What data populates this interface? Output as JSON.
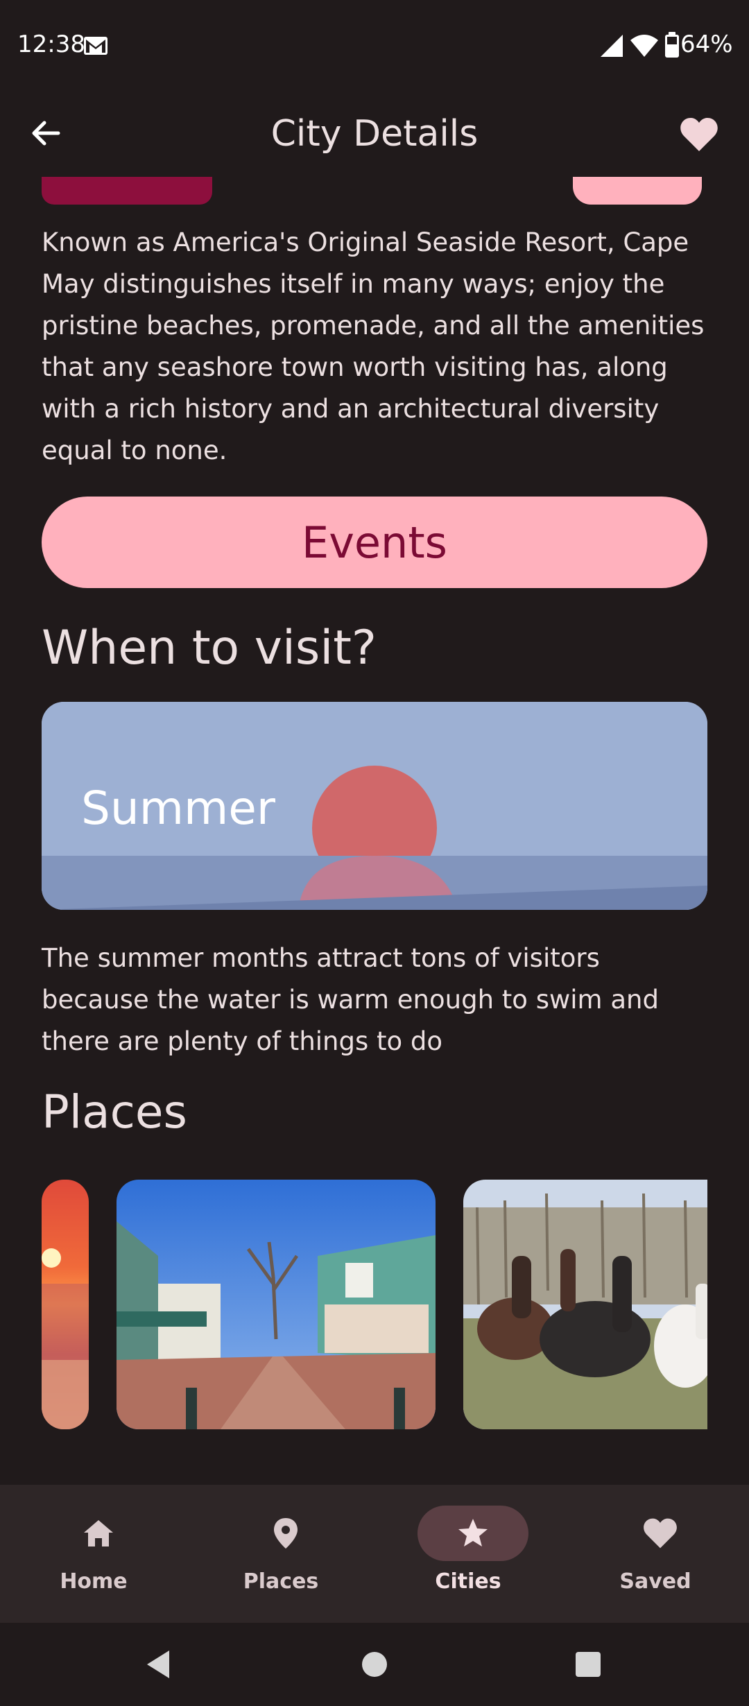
{
  "status_bar": {
    "time": "12:38",
    "battery": "64%"
  },
  "app_bar": {
    "title": "City Details"
  },
  "city": {
    "description": "Known as America's Original Seaside Resort, Cape May distinguishes itself in many ways; enjoy the pristine beaches, promenade, and all the amenities that any seashore town worth visiting has, along with a rich history and an architectural diversity equal to none.",
    "events_label": "Events"
  },
  "visit": {
    "heading": "When to visit?",
    "season": "Summer",
    "season_description": "The summer months attract tons of visitors because the water is warm enough to swim and there are plenty of things to do"
  },
  "places": {
    "heading": "Places"
  },
  "bottom_nav": {
    "items": [
      {
        "label": "Home",
        "icon": "home-icon"
      },
      {
        "label": "Places",
        "icon": "location-pin-icon"
      },
      {
        "label": "Cities",
        "icon": "star-icon",
        "active": true
      },
      {
        "label": "Saved",
        "icon": "heart-icon"
      }
    ]
  },
  "colors": {
    "background": "#201a1b",
    "primary_container": "#ffb1bd",
    "on_primary_container": "#7b0a34",
    "nav_background": "#2e2627",
    "nav_active_indicator": "#5b3f44"
  }
}
